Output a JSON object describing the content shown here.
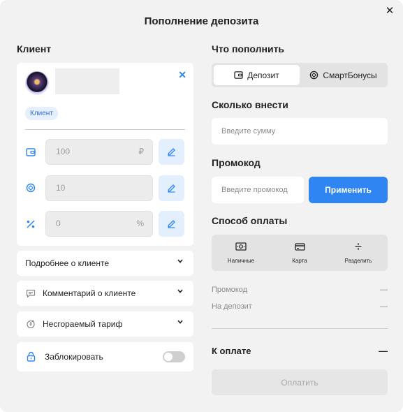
{
  "title": "Пополнение депозита",
  "client": {
    "heading": "Клиент",
    "badge": "Клиент",
    "fields": [
      {
        "icon": "wallet-icon",
        "value": "100",
        "unit": "₽"
      },
      {
        "icon": "bonus-icon",
        "value": "10",
        "unit": ""
      },
      {
        "icon": "percent-icon",
        "value": "0",
        "unit": "%"
      }
    ],
    "accordions": {
      "details": "Подробнее о клиенте",
      "comment": "Комментарий о клиенте",
      "tariff": "Несгораемый тариф",
      "block": "Заблокировать"
    },
    "block_enabled": false
  },
  "topup": {
    "heading": "Что пополнить",
    "tabs": [
      "Депозит",
      "СмартБонусы"
    ],
    "active_tab": "Депозит"
  },
  "amount": {
    "heading": "Сколько внести",
    "placeholder": "Введите сумму"
  },
  "promo": {
    "heading": "Промокод",
    "placeholder": "Введите промокод",
    "apply_label": "Применить"
  },
  "payment": {
    "heading": "Способ оплаты",
    "methods": [
      "Наличные",
      "Карта",
      "Разделить"
    ]
  },
  "summary": {
    "rows": [
      {
        "label": "Промокод",
        "value": "—"
      },
      {
        "label": "На депозит",
        "value": "—"
      }
    ],
    "total_label": "К оплате",
    "total_value": "—",
    "pay_label": "Оплатить"
  },
  "colors": {
    "accent": "#2f86f2",
    "badge_bg": "#e5effd",
    "panel_bg": "#f2f2f2"
  }
}
